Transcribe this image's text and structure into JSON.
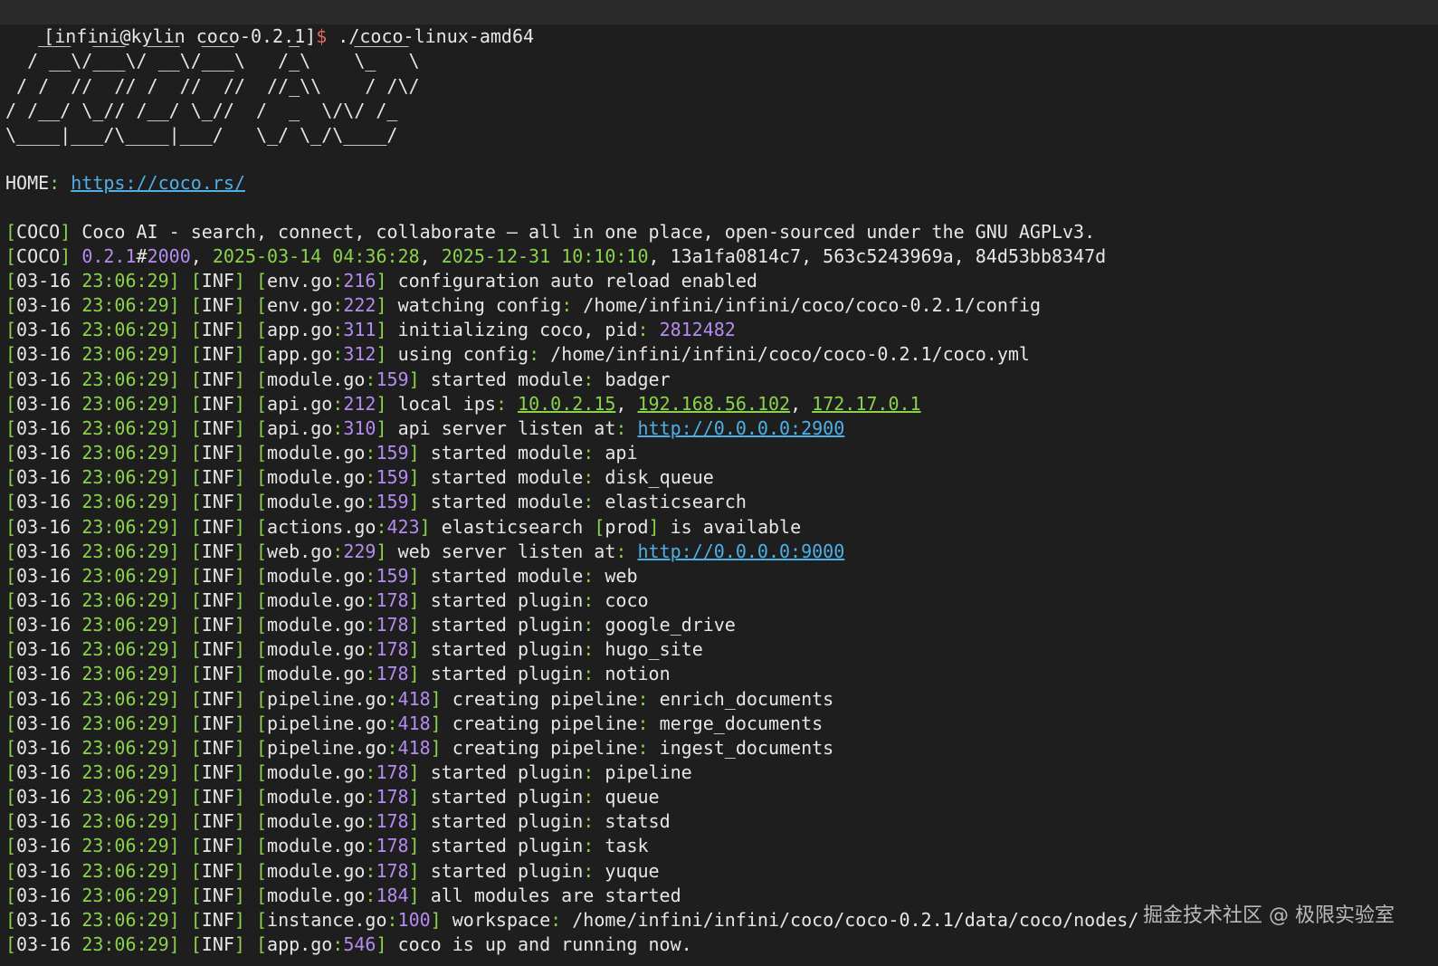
{
  "prompt": {
    "host": "[infini@kylin coco-0.2.1]",
    "dollar": "$",
    "command": " ./coco-linux-amd64"
  },
  "ascii_art": [
    "   ___  ___  ___  ___     _     _____",
    "  / __\\/___\\/ __\\/___\\   /_\\    \\_   \\",
    " / /  //  // /  //  //  //_\\\\    / /\\/",
    "/ /__/ \\_// /__/ \\_//  /  _  \\/\\/ /_",
    "\\____|___/\\____|___/   \\_/ \\_/\\____/"
  ],
  "home": {
    "label": "HOME",
    "url": "https://coco.rs/"
  },
  "coco_lines": {
    "tag": "COCO",
    "desc": "Coco AI - search, connect, collaborate – all in one place, open-sourced under the GNU AGPLv3.",
    "version": "0.2.1",
    "build": "2000",
    "build_date": "2025-03-14 04:36:28",
    "eol_date": "2025-12-31 10:10:10",
    "hashes": ", 13a1fa0814c7, 563c5243969a, 84d53bb8347d"
  },
  "log": {
    "date": "03-16",
    "time": "23:06:29",
    "level": "INF",
    "entries": [
      {
        "file": "env.go",
        "line": "216",
        "msg": "configuration auto reload enabled"
      },
      {
        "file": "env.go",
        "line": "222",
        "msg": "watching config",
        "value": "/home/infini/infini/coco/coco-0.2.1/config"
      },
      {
        "file": "app.go",
        "line": "311",
        "msg": "initializing coco, pid",
        "num": "2812482"
      },
      {
        "file": "app.go",
        "line": "312",
        "msg": "using config",
        "value": "/home/infini/infini/coco/coco-0.2.1/coco.yml"
      },
      {
        "file": "module.go",
        "line": "159",
        "msg": "started module",
        "value": "badger"
      },
      {
        "file": "api.go",
        "line": "212",
        "msg": "local ips",
        "ips": [
          "10.0.2.15",
          "192.168.56.102",
          "172.17.0.1"
        ]
      },
      {
        "file": "api.go",
        "line": "310",
        "msg": "api server listen at",
        "url": "http://0.0.0.0:2900"
      },
      {
        "file": "module.go",
        "line": "159",
        "msg": "started module",
        "value": "api"
      },
      {
        "file": "module.go",
        "line": "159",
        "msg": "started module",
        "value": "disk_queue"
      },
      {
        "file": "module.go",
        "line": "159",
        "msg": "started module",
        "value": "elasticsearch"
      },
      {
        "file": "actions.go",
        "line": "423",
        "msg": "elasticsearch ",
        "bracket": "prod",
        "tail": " is available"
      },
      {
        "file": "web.go",
        "line": "229",
        "msg": "web server listen at",
        "url": "http://0.0.0.0:9000"
      },
      {
        "file": "module.go",
        "line": "159",
        "msg": "started module",
        "value": "web"
      },
      {
        "file": "module.go",
        "line": "178",
        "msg": "started plugin",
        "value": "coco"
      },
      {
        "file": "module.go",
        "line": "178",
        "msg": "started plugin",
        "value": "google_drive"
      },
      {
        "file": "module.go",
        "line": "178",
        "msg": "started plugin",
        "value": "hugo_site"
      },
      {
        "file": "module.go",
        "line": "178",
        "msg": "started plugin",
        "value": "notion"
      },
      {
        "file": "pipeline.go",
        "line": "418",
        "msg": "creating pipeline",
        "value": "enrich_documents"
      },
      {
        "file": "pipeline.go",
        "line": "418",
        "msg": "creating pipeline",
        "value": "merge_documents"
      },
      {
        "file": "pipeline.go",
        "line": "418",
        "msg": "creating pipeline",
        "value": "ingest_documents"
      },
      {
        "file": "module.go",
        "line": "178",
        "msg": "started plugin",
        "value": "pipeline"
      },
      {
        "file": "module.go",
        "line": "178",
        "msg": "started plugin",
        "value": "queue"
      },
      {
        "file": "module.go",
        "line": "178",
        "msg": "started plugin",
        "value": "statsd"
      },
      {
        "file": "module.go",
        "line": "178",
        "msg": "started plugin",
        "value": "task"
      },
      {
        "file": "module.go",
        "line": "178",
        "msg": "started plugin",
        "value": "yuque"
      },
      {
        "file": "module.go",
        "line": "184",
        "msg": "all modules are started"
      },
      {
        "file": "instance.go",
        "line": "100",
        "msg": "workspace",
        "value": "/home/infini/infini/coco/coco-0.2.1/data/coco/nodes/"
      },
      {
        "file": "app.go",
        "line": "546",
        "msg": "coco is up and running now."
      }
    ]
  },
  "watermark": "掘金技术社区 @ 极限实验室",
  "colors": {
    "background": "#1e1e1e",
    "text": "#e6e6e6",
    "green": "#8bd24a",
    "purple": "#b48cf0",
    "link": "#4fb0e6",
    "prompt_dollar": "#e06c5a"
  }
}
